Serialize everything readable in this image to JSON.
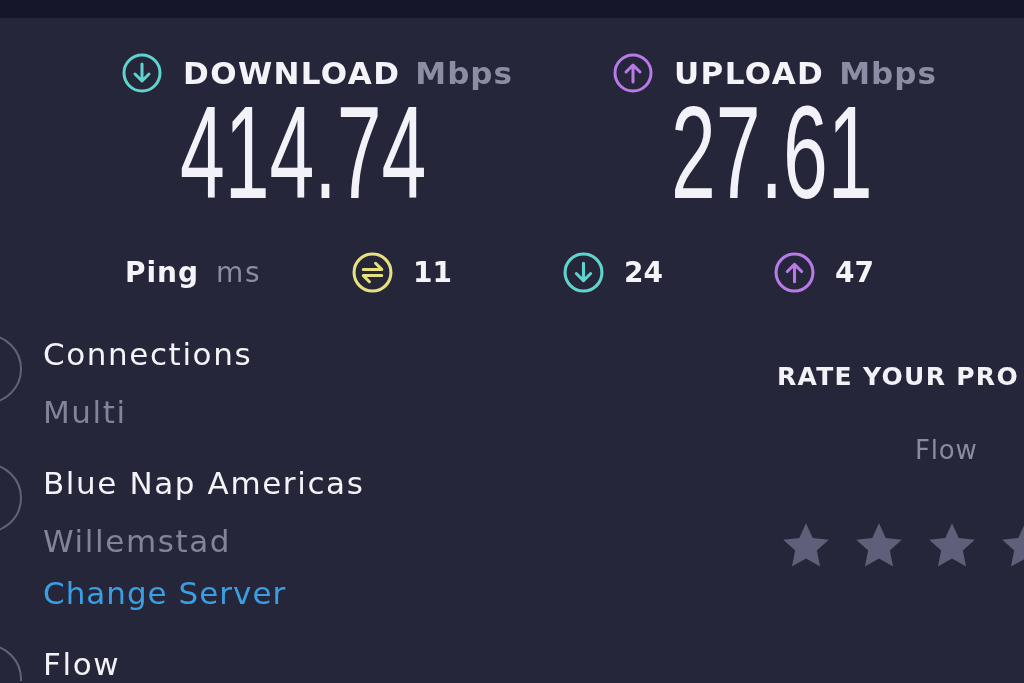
{
  "speeds": [
    {
      "kind": "download",
      "label": "DOWNLOAD",
      "unit": "Mbps",
      "value": "414.74"
    },
    {
      "kind": "upload",
      "label": "UPLOAD",
      "unit": "Mbps",
      "value": "27.61"
    }
  ],
  "ping": {
    "label": "Ping",
    "unit": "ms",
    "readings": [
      {
        "kind": "idle",
        "value": "11"
      },
      {
        "kind": "download",
        "value": "24"
      },
      {
        "kind": "upload",
        "value": "47"
      }
    ]
  },
  "details": [
    {
      "title": "Connections",
      "subtitle": "Multi"
    },
    {
      "title": "Blue Nap Americas",
      "subtitle": "Willemstad",
      "link": "Change Server"
    },
    {
      "title": "Flow"
    }
  ],
  "rating": {
    "title": "RATE YOUR PRO",
    "provider": "Flow"
  }
}
